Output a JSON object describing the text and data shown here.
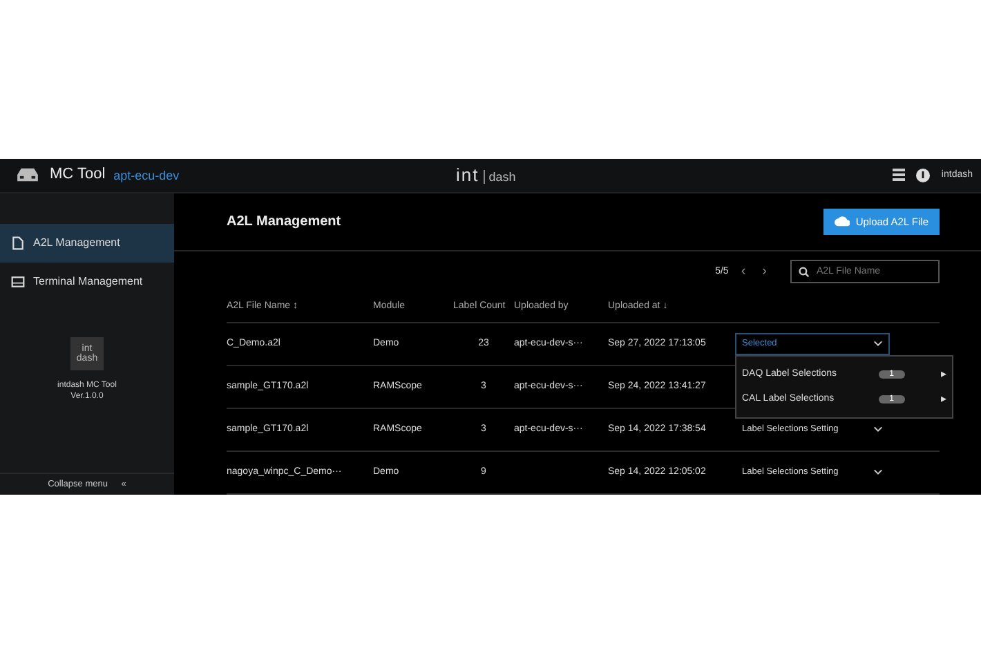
{
  "header": {
    "app_name": "MC Tool",
    "project": "apt-ecu-dev",
    "logo_left": "int",
    "logo_right": "dash",
    "user": "intdash"
  },
  "sidebar": {
    "items": [
      {
        "label": "A2L Management",
        "selected": true
      },
      {
        "label": "Terminal Management",
        "selected": false
      }
    ],
    "app_logo_top": "int",
    "app_logo_bottom": "dash",
    "app_name": "intdash MC Tool",
    "version": "Ver.1.0.0",
    "collapse": "Collapse menu",
    "collapse_glyph": "«"
  },
  "page": {
    "title": "A2L Management",
    "upload_button": "Upload A2L File"
  },
  "pager": {
    "count": "5/5",
    "prev": "‹",
    "next": "›"
  },
  "search": {
    "placeholder": "A2L File Name"
  },
  "table": {
    "columns": [
      "A2L File Name ↕",
      "Module",
      "Label Count",
      "Uploaded by",
      "Uploaded at ↓"
    ],
    "rows": [
      {
        "file": "C_Demo.a2l",
        "module": "Demo",
        "count": "23",
        "by": "apt-ecu-dev-s···",
        "at": "Sep 27, 2022 17:13:05",
        "setting": "Selected",
        "open": true,
        "menu": [
          {
            "label": "DAQ Label Selections",
            "count": "1",
            "arrow": "▸"
          },
          {
            "label": "CAL Label Selections",
            "count": "1",
            "arrow": "▸"
          }
        ]
      },
      {
        "file": "sample_GT170.a2l",
        "module": "RAMScope",
        "count": "3",
        "by": "apt-ecu-dev-s···",
        "at": "Sep 24, 2022 13:41:27"
      },
      {
        "file": "sample_GT170.a2l",
        "module": "RAMScope",
        "count": "3",
        "by": "apt-ecu-dev-s···",
        "at": "Sep 14, 2022 17:38:54",
        "setting": "Label Selections Setting"
      },
      {
        "file": "nagoya_winpc_C_Demo···",
        "module": "Demo",
        "count": "9",
        "at": "Sep 14, 2022 12:05:02",
        "setting": "Label Selections Setting"
      }
    ]
  }
}
